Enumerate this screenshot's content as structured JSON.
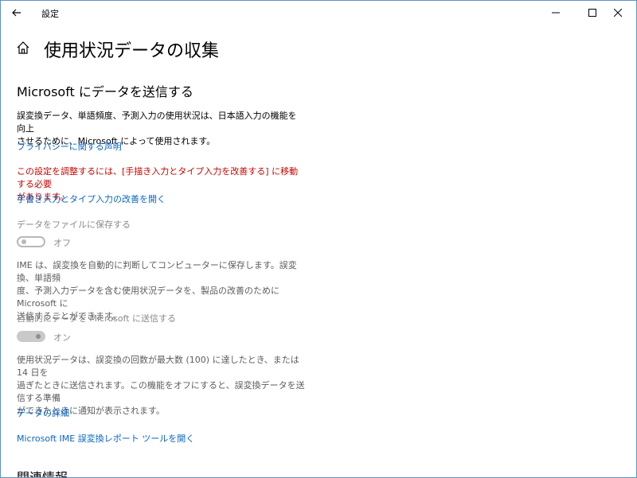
{
  "window": {
    "title": "設定"
  },
  "page": {
    "title": "使用状況データの収集"
  },
  "section": {
    "title": "Microsoft にデータを送信する",
    "intro_line1": "誤変換データ、単語頻度、予測入力の使用状況は、日本語入力の機能を向上",
    "intro_line2": "させるために、Microsoft によって使用されます。",
    "privacy_link": "プライバシーに関する声明",
    "warning_line1": "この設定を調整するには、[手描き入力とタイプ入力を改善する] に移動する必要",
    "warning_line2": "があります。",
    "handwriting_link": "手書き入力とタイプ入力の改善を開く"
  },
  "save_to_file": {
    "label": "データをファイルに保存する",
    "state": "オフ",
    "desc_line1": "IME は、誤変換を自動的に判断してコンピューターに保存します。誤変換、単語頻",
    "desc_line2": "度、予測入力データを含む使用状況データを、製品の改善のために Microsoft に",
    "desc_line3": "送信することができます。"
  },
  "auto_send": {
    "label": "自動的にデータを Microsoft に送信する",
    "state": "オン",
    "desc_line1": "使用状況データは、誤変換の回数が最大数 (100) に達したとき、または 14 日を",
    "desc_line2": "過ぎたときに送信されます。この機能をオフにすると、誤変換データを送信する準備",
    "desc_line3": "ができたときに通知が表示されます。"
  },
  "links": {
    "data_details": "データの詳細",
    "report_tool": "Microsoft IME 誤変換レポート ツールを開く"
  },
  "related": {
    "title": "関連情報"
  },
  "colors": {
    "link": "#0a66c2",
    "warning": "#c50500",
    "disabled": "#8a8a8a",
    "border": "#5a93c8"
  },
  "icons": {
    "back": "back-arrow-icon",
    "home": "home-icon",
    "minimize": "minimize-icon",
    "maximize": "maximize-icon",
    "close": "close-icon"
  }
}
